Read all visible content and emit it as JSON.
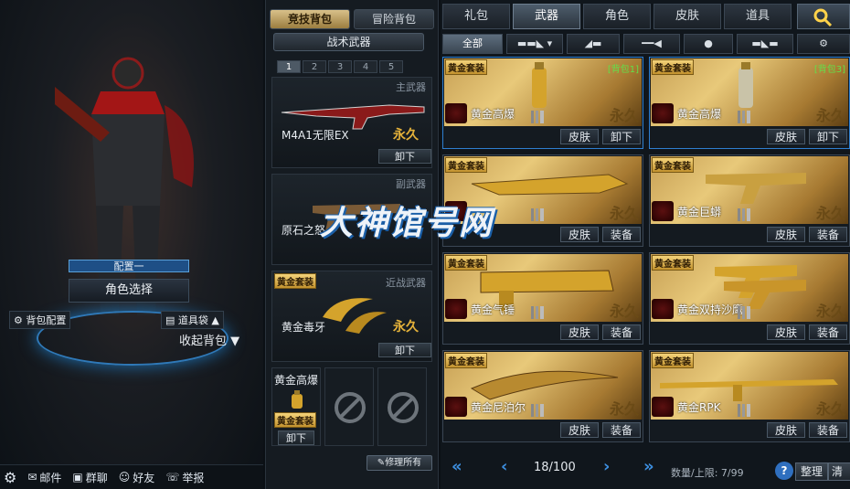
{
  "left": {
    "config_label": "配置一",
    "char_select": "角色选择",
    "bag_config": "背包配置",
    "tool_bag": "道具袋",
    "collapse_bag": "收起背包",
    "bottom": {
      "mail": "邮件",
      "group_chat": "群聊",
      "friends": "好友",
      "report": "举报"
    }
  },
  "mid": {
    "tab_competitive": "竞技背包",
    "tab_adventure": "冒险背包",
    "tactical": "战术武器",
    "pages": [
      "1",
      "2",
      "3",
      "4",
      "5"
    ],
    "active_page": "1",
    "primary": {
      "type": "主武器",
      "name": "M4A1无限EX",
      "perm": "永久",
      "action": "卸下"
    },
    "secondary": {
      "type": "副武器",
      "name": "原石之怒"
    },
    "melee": {
      "type": "近战武器",
      "tag": "黄金套装",
      "name": "黄金毒牙",
      "perm": "永久",
      "action": "卸下"
    },
    "grenade": {
      "name": "黄金高爆",
      "tag": "黄金套装",
      "action": "卸下"
    },
    "repair": "修理所有"
  },
  "right": {
    "categories": [
      "礼包",
      "武器",
      "角色",
      "皮肤",
      "道具"
    ],
    "active_category": "武器",
    "sub_all": "全部",
    "items": [
      {
        "tag": "黄金套装",
        "pkg": "[背包1]",
        "name": "黄金高爆",
        "perm": "永久",
        "b1": "皮肤",
        "b2": "卸下"
      },
      {
        "tag": "黄金套装",
        "pkg": "[背包3]",
        "name": "黄金高爆",
        "perm": "永久",
        "b1": "皮肤",
        "b2": "卸下"
      },
      {
        "tag": "黄金套装",
        "pkg": "",
        "name": "",
        "perm": "永久",
        "b1": "皮肤",
        "b2": "装备"
      },
      {
        "tag": "黄金套装",
        "pkg": "",
        "name": "黄金巨蟒",
        "perm": "永久",
        "b1": "皮肤",
        "b2": "装备"
      },
      {
        "tag": "黄金套装",
        "pkg": "",
        "name": "黄金气锤",
        "perm": "永久",
        "b1": "皮肤",
        "b2": "装备"
      },
      {
        "tag": "黄金套装",
        "pkg": "",
        "name": "黄金双持沙鹰",
        "perm": "永久",
        "b1": "皮肤",
        "b2": "装备"
      },
      {
        "tag": "黄金套装",
        "pkg": "",
        "name": "黄金尼泊尔",
        "perm": "永久",
        "b1": "皮肤",
        "b2": "装备"
      },
      {
        "tag": "黄金套装",
        "pkg": "",
        "name": "黄金RPK",
        "perm": "永久",
        "b1": "皮肤",
        "b2": "装备"
      }
    ],
    "page": "18/100",
    "quantity": "数量/上限: 7/99",
    "sort": "整理",
    "clear": "清除"
  },
  "watermark": "大神馆号网",
  "colors": {
    "gold": "#e5b23a",
    "accent_blue": "#3d8fe0",
    "package_green": "#62e04a"
  }
}
